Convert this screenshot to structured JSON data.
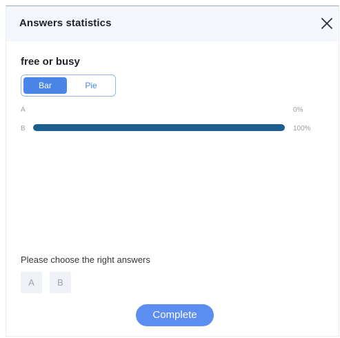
{
  "dialog": {
    "title": "Answers statistics",
    "close_icon": "close-icon"
  },
  "question": {
    "title": "free or busy"
  },
  "view_toggle": {
    "options": [
      "Bar",
      "Pie"
    ],
    "selected": "Bar"
  },
  "stats": {
    "rows": [
      {
        "label": "A",
        "percent_text": "0%",
        "value": 0
      },
      {
        "label": "B",
        "percent_text": "100%",
        "value": 100
      }
    ],
    "bar_color": "#1d5e8f"
  },
  "answers": {
    "instruction": "Please choose the right answers",
    "options": [
      "A",
      "B"
    ]
  },
  "actions": {
    "complete_label": "Complete"
  },
  "colors": {
    "accent": "#4a86e8",
    "button": "#5b8ef0",
    "header_bg": "#f4f7fb"
  }
}
